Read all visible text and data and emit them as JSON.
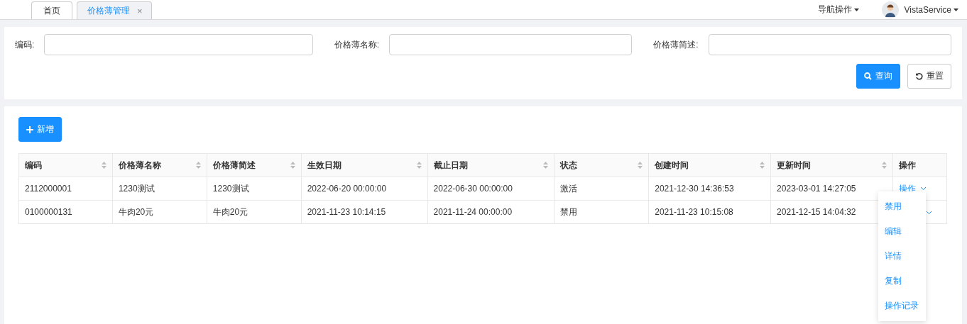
{
  "tabs": [
    {
      "label": "首页",
      "selected": false
    },
    {
      "label": "价格薄管理",
      "selected": true,
      "close": "×"
    }
  ],
  "header": {
    "nav_menu": "导航操作",
    "user": "VistaService"
  },
  "filters": [
    {
      "label": "编码:"
    },
    {
      "label": "价格薄名称:"
    },
    {
      "label": "价格薄简述:"
    }
  ],
  "filter_buttons": {
    "search": "查询",
    "reset": "重置"
  },
  "add_button": "新增",
  "table": {
    "columns": [
      {
        "label": "编码",
        "sortable": true
      },
      {
        "label": "价格薄名称",
        "sortable": true
      },
      {
        "label": "价格薄简述",
        "sortable": true
      },
      {
        "label": "生效日期",
        "sortable": true
      },
      {
        "label": "截止日期",
        "sortable": true
      },
      {
        "label": "状态",
        "sortable": true
      },
      {
        "label": "创建时间",
        "sortable": true
      },
      {
        "label": "更新时间",
        "sortable": true
      },
      {
        "label": "操作",
        "sortable": false
      }
    ],
    "rows": [
      {
        "cells": [
          "2112000001",
          "1230测试",
          "1230测试",
          "2022-06-20 00:00:00",
          "2022-06-30 00:00:00",
          "激活",
          "2021-12-30 14:36:53",
          "2023-03-01 14:27:05"
        ],
        "action": "操作"
      },
      {
        "cells": [
          "0100000131",
          "牛肉20元",
          "牛肉20元",
          "2021-11-23 10:14:15",
          "2021-11-24 00:00:00",
          "禁用",
          "2021-11-23 10:15:08",
          "2021-12-15 14:04:32"
        ]
      }
    ]
  },
  "action_menu": {
    "items": [
      "禁用",
      "编辑",
      "详情",
      "复制",
      "操作记录"
    ]
  }
}
